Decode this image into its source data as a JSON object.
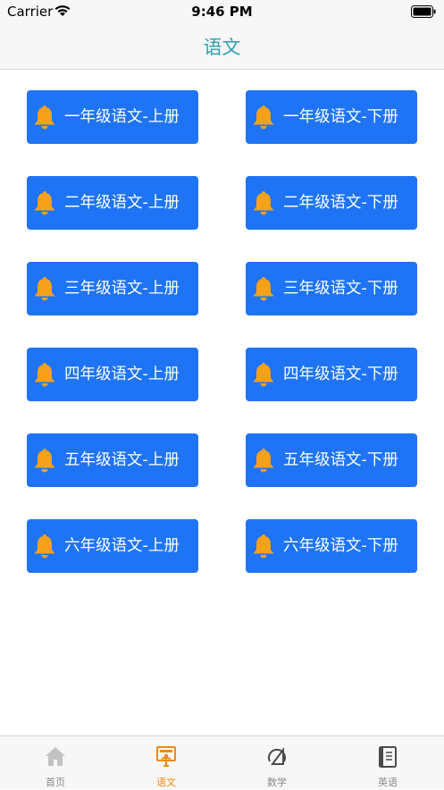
{
  "status_bar": {
    "carrier": "Carrier",
    "time": "9:46 PM"
  },
  "nav": {
    "title": "语文"
  },
  "grades": {
    "items": [
      {
        "left": "一年级语文-上册",
        "right": "一年级语文-下册"
      },
      {
        "left": "二年级语文-上册",
        "right": "二年级语文-下册"
      },
      {
        "left": "三年级语文-上册",
        "right": "三年级语文-下册"
      },
      {
        "left": "四年级语文-上册",
        "right": "四年级语文-下册"
      },
      {
        "left": "五年级语文-上册",
        "right": "五年级语文-下册"
      },
      {
        "left": "六年级语文-上册",
        "right": "六年级语文-下册"
      }
    ]
  },
  "tabs": [
    {
      "label": "首页",
      "icon": "home-icon"
    },
    {
      "label": "语文",
      "icon": "chinese-icon"
    },
    {
      "label": "数学",
      "icon": "math-icon"
    },
    {
      "label": "英语",
      "icon": "english-icon"
    }
  ],
  "colors": {
    "button": "#1e74f4",
    "bell": "#f5a11c",
    "title": "#2a9fb1",
    "tab_active": "#f08a12",
    "tab_inactive": "#8a8a8a"
  }
}
